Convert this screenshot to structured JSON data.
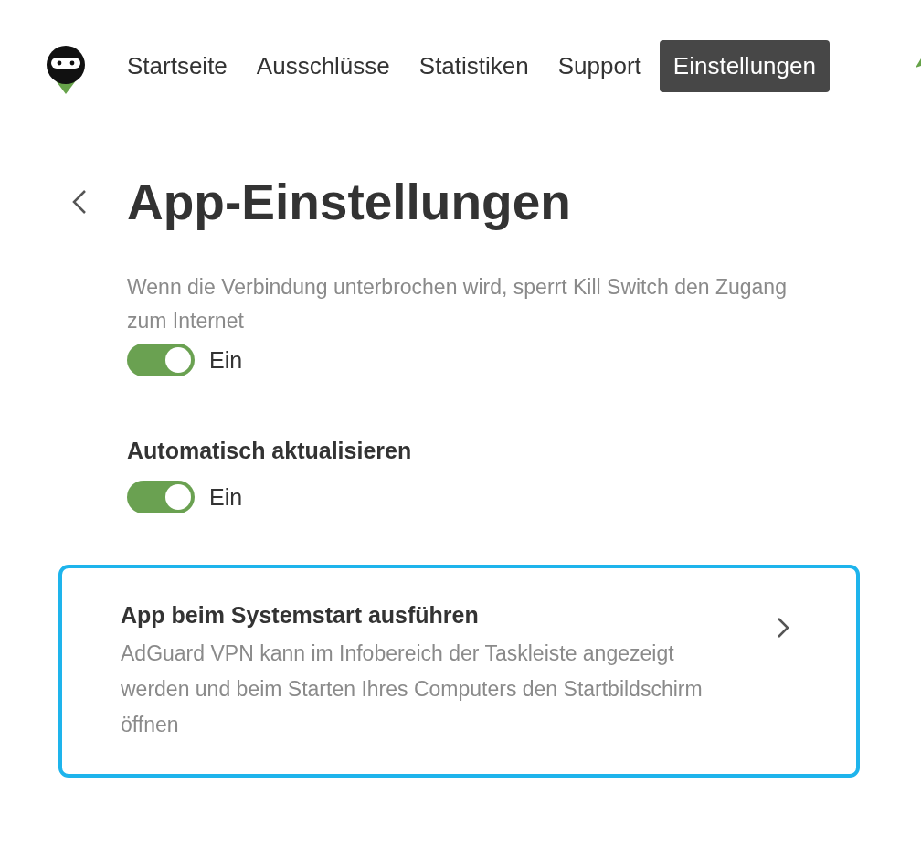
{
  "nav": {
    "items": [
      {
        "label": "Startseite",
        "selected": false
      },
      {
        "label": "Ausschlüsse",
        "selected": false
      },
      {
        "label": "Statistiken",
        "selected": false
      },
      {
        "label": "Support",
        "selected": false
      },
      {
        "label": "Einstellungen",
        "selected": true
      }
    ]
  },
  "page": {
    "title": "App-Einstellungen"
  },
  "settings": [
    {
      "kind": "description",
      "text": "Wenn die Verbindung unterbrochen wird, sperrt Kill Switch den Zugang zum Internet",
      "on": true,
      "state_label": "Ein"
    },
    {
      "kind": "heading",
      "text": "Automatisch aktualisieren",
      "on": true,
      "state_label": "Ein"
    }
  ],
  "card": {
    "title": "App beim Systemstart ausführen",
    "description": "AdGuard VPN kann im Infobereich der Taskleiste angezeigt werden und beim Starten Ihres Computers den Startbildschirm öffnen",
    "selected": true
  }
}
